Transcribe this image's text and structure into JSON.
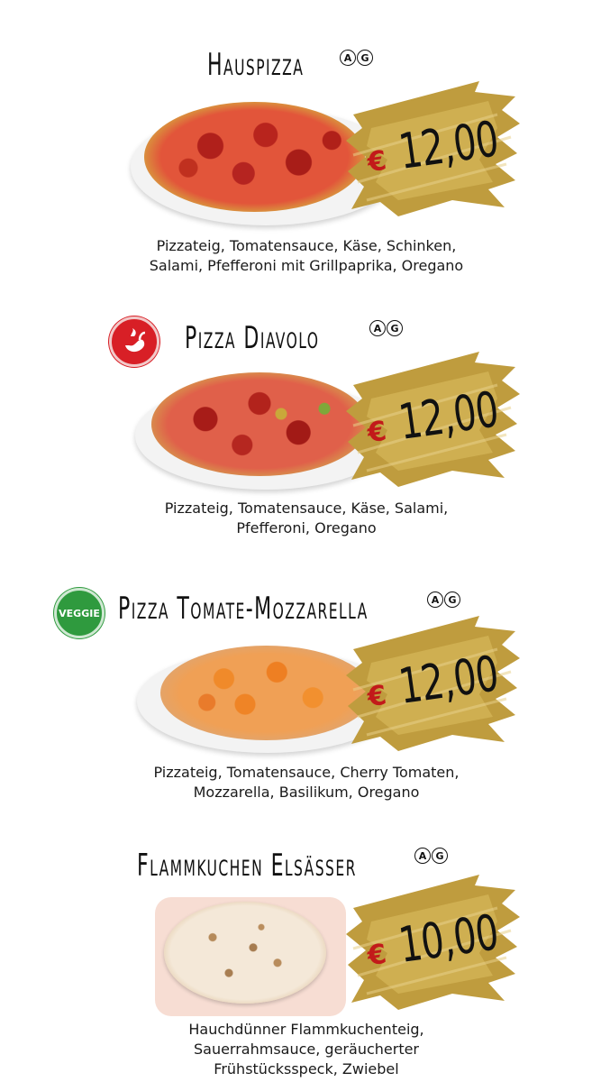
{
  "items": [
    {
      "name": "Hauspizza",
      "allergens": [
        "A",
        "G"
      ],
      "currency": "€",
      "price": "12,00",
      "description_lines": [
        "Pizzateig, Tomatensauce, Käse, Schinken,",
        "Salami, Pfefferoni mit Grillpaprika, Oregano"
      ],
      "badge": ""
    },
    {
      "name": "Pizza Diavolo",
      "allergens": [
        "A",
        "G"
      ],
      "currency": "€",
      "price": "12,00",
      "description_lines": [
        "Pizzateig, Tomatensauce, Käse, Salami,",
        "Pfefferoni, Oregano"
      ],
      "badge": "chili-icon"
    },
    {
      "name": "Pizza Tomate-Mozzarella",
      "allergens": [
        "A",
        "G"
      ],
      "currency": "€",
      "price": "12,00",
      "description_lines": [
        "Pizzateig, Tomatensauce, Cherry Tomaten,",
        "Mozzarella, Basilikum, Oregano"
      ],
      "badge": "veggie-icon",
      "badge_text": "VEGGIE"
    },
    {
      "name": "Flammkuchen Elsässer",
      "allergens": [
        "A",
        "G"
      ],
      "currency": "€",
      "price": "10,00",
      "description_lines": [
        "Hauchdünner Flammkuchenteig,",
        "Sauerrahmsauce, geräucherter",
        "Frühstücksspeck, Zwiebel"
      ],
      "badge": ""
    }
  ],
  "colors": {
    "gold": "#b8963a",
    "price_currency": "#c21a1a",
    "hot_badge": "#d81f26",
    "veggie_badge": "#2f9a3e"
  }
}
